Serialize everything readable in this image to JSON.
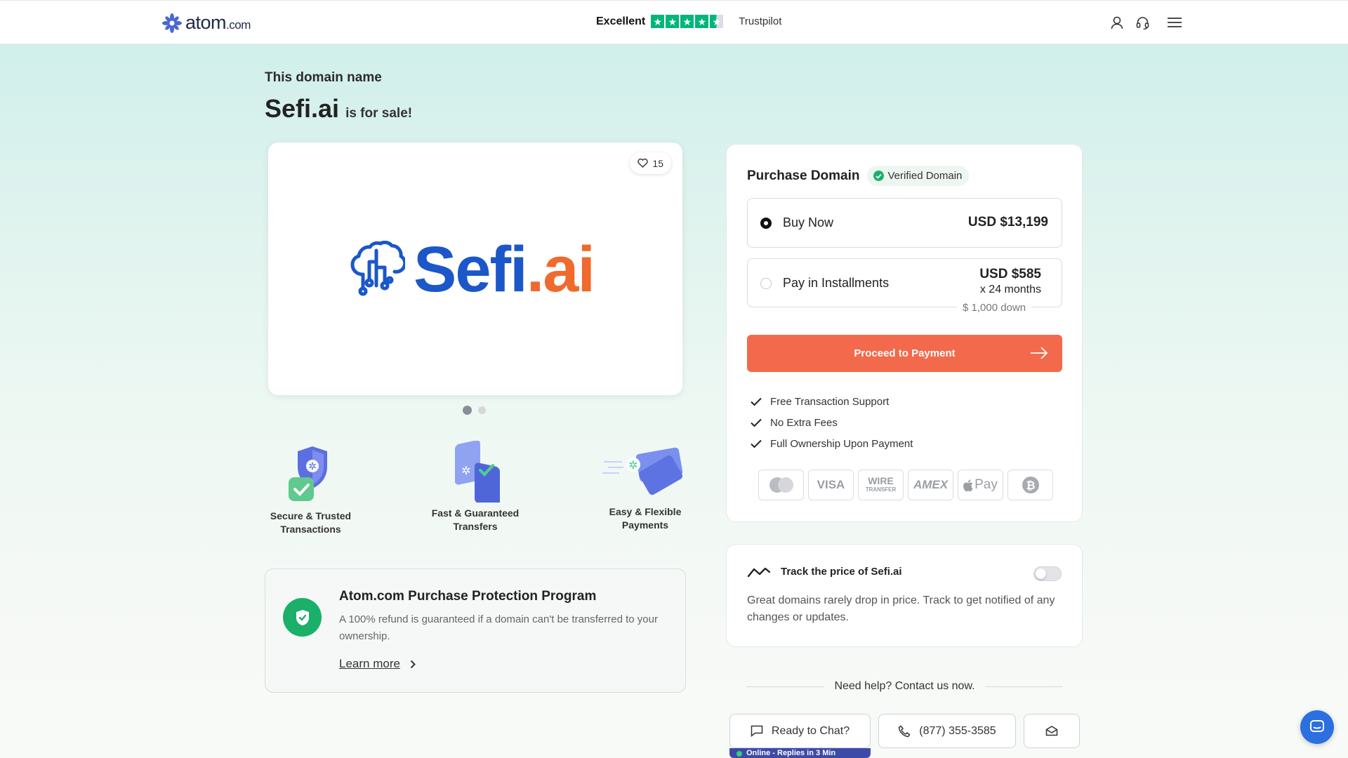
{
  "header": {
    "logo_text": "atom",
    "logo_suffix": ".com",
    "trust_rating": "Excellent",
    "trust_brand": "Trustpilot",
    "stars": 4.5,
    "icons": [
      "user-icon",
      "headset-icon",
      "menu-icon"
    ]
  },
  "hero": {
    "subtitle": "This domain name",
    "domain": "Sefi.ai",
    "for_sale": "is for sale!"
  },
  "preview": {
    "likes": "15",
    "brand_part1": "Sefi",
    "brand_part2": ".ai",
    "brand_colors": {
      "primary": "#1b57c9",
      "accent": "#ef6a2c"
    },
    "slides": 2,
    "active_slide": 1
  },
  "features": [
    {
      "label_line1": "Secure & Trusted",
      "label_line2": "Transactions",
      "icon": "shield-icon"
    },
    {
      "label_line1": "Fast & Guaranteed",
      "label_line2": "Transfers",
      "icon": "transfer-icon"
    },
    {
      "label_line1": "Easy & Flexible",
      "label_line2": "Payments",
      "icon": "card-icon"
    }
  ],
  "protection": {
    "title": "Atom.com Purchase Protection Program",
    "description": "A 100% refund is guaranteed if a domain can't be transferred to your ownership.",
    "link": "Learn more"
  },
  "purchase": {
    "title": "Purchase Domain",
    "verified": "Verified Domain",
    "option_buy": {
      "label": "Buy Now",
      "price": "USD $13,199",
      "selected": true
    },
    "option_installments": {
      "label": "Pay in Installments",
      "price": "USD $585",
      "months": "x 24 months",
      "down": "$ 1,000 down",
      "selected": false
    },
    "proceed": "Proceed to Payment",
    "benefits": [
      "Free Transaction Support",
      "No Extra Fees",
      "Full Ownership Upon Payment"
    ],
    "payment_methods": {
      "mastercard": "mastercard-icon",
      "visa": "VISA",
      "wire_line1": "WIRE",
      "wire_line2": "TRANSFER",
      "amex": "AMEX",
      "applepay": "Pay",
      "bitcoin": "bitcoin-icon"
    },
    "accent_color": "#f26a4b"
  },
  "track": {
    "title": "Track the price of Sefi.ai",
    "description": "Great domains rarely drop in price. Track to get notified of any changes or updates.",
    "enabled": false
  },
  "help": {
    "heading": "Need help? Contact us now.",
    "chat_button": "Ready to Chat?",
    "phone_button": "(877) 355-3585",
    "status": "Online - Replies in 3 Min"
  }
}
